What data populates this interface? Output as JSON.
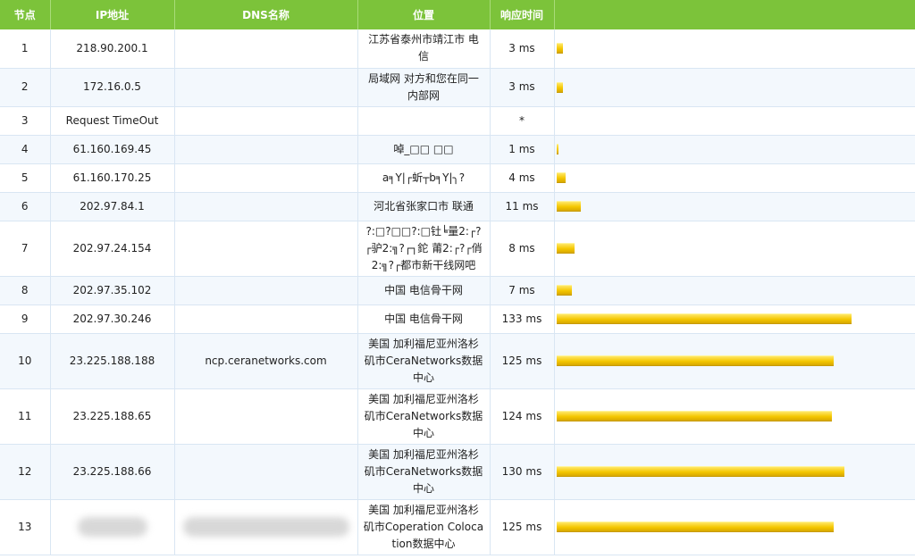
{
  "table": {
    "headers": [
      "节点",
      "IP地址",
      "DNS名称",
      "位置",
      "响应时间",
      ""
    ],
    "rows": [
      {
        "node": "1",
        "ip": "218.90.200.1",
        "dns": "",
        "location": "江苏省泰州市靖江市 电信",
        "time": "3 ms",
        "ms": 3
      },
      {
        "node": "2",
        "ip": "172.16.0.5",
        "dns": "",
        "location": "局域网 对方和您在同一内部网",
        "time": "3 ms",
        "ms": 3
      },
      {
        "node": "3",
        "ip": "Request TimeOut",
        "dns": "",
        "location": "",
        "time": "*",
        "ms": 0
      },
      {
        "node": "4",
        "ip": "61.160.169.45",
        "dns": "",
        "location": "啅_□□ □□",
        "time": "1 ms",
        "ms": 1
      },
      {
        "node": "5",
        "ip": "61.160.170.25",
        "dns": "",
        "location": "a╕Y|┌蚚┬b╕Y|╮?",
        "time": "4 ms",
        "ms": 4
      },
      {
        "node": "6",
        "ip": "202.97.84.1",
        "dns": "",
        "location": "河北省张家口市 联通",
        "time": "11 ms",
        "ms": 11
      },
      {
        "node": "7",
        "ip": "202.97.24.154",
        "dns": "",
        "location": "?:□?□□?:□钍╘量2:┌?┌驴2:╗?┌┐鉈 莆2:┌?┌俏2:╗?┌都市新干线网吧",
        "time": "8 ms",
        "ms": 8
      },
      {
        "node": "8",
        "ip": "202.97.35.102",
        "dns": "",
        "location": "中国 电信骨干网",
        "time": "7 ms",
        "ms": 7
      },
      {
        "node": "9",
        "ip": "202.97.30.246",
        "dns": "",
        "location": "中国 电信骨干网",
        "time": "133 ms",
        "ms": 133
      },
      {
        "node": "10",
        "ip": "23.225.188.188",
        "dns": "ncp.ceranetworks.com",
        "location": "美国 加利福尼亚州洛杉矶市CeraNetworks数据中心",
        "time": "125 ms",
        "ms": 125
      },
      {
        "node": "11",
        "ip": "23.225.188.65",
        "dns": "",
        "location": "美国 加利福尼亚州洛杉矶市CeraNetworks数据中心",
        "time": "124 ms",
        "ms": 124
      },
      {
        "node": "12",
        "ip": "23.225.188.66",
        "dns": "",
        "location": "美国 加利福尼亚州洛杉矶市CeraNetworks数据中心",
        "time": "130 ms",
        "ms": 130
      },
      {
        "node": "13",
        "ip": "",
        "dns": "",
        "location": "美国 加利福尼亚州洛杉矶市Coperation Colocation数据中心",
        "time": "125 ms",
        "ms": 125,
        "redacted": true
      }
    ]
  }
}
